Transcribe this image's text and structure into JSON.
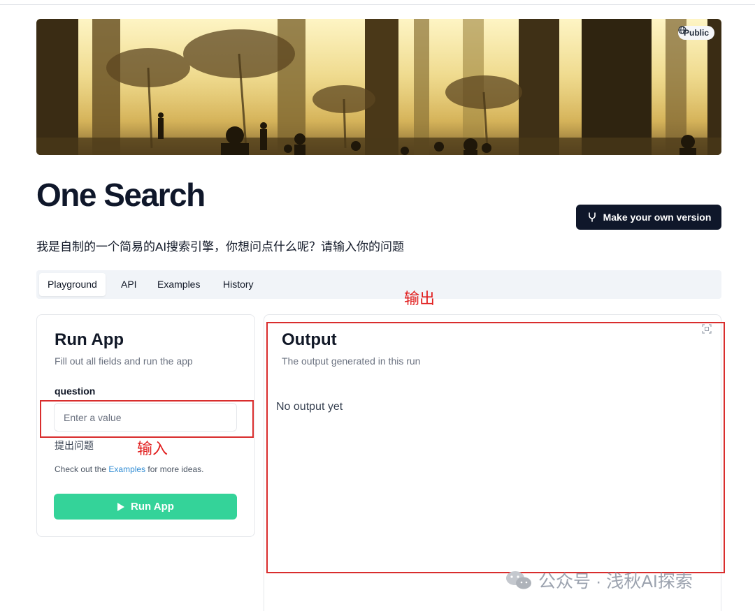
{
  "banner": {
    "visibility_label": "Public",
    "visibility_icon": "globe-icon"
  },
  "app": {
    "title": "One Search",
    "description": "我是自制的一个简易的AI搜索引擎，你想问点什么呢？请输入你的问题",
    "make_own_label": "Make your own version",
    "make_own_icon": "fork-icon"
  },
  "tabs": [
    {
      "label": "Playground",
      "active": true
    },
    {
      "label": "API",
      "active": false
    },
    {
      "label": "Examples",
      "active": false
    },
    {
      "label": "History",
      "active": false
    }
  ],
  "annotations": {
    "output": "输出",
    "input": "输入",
    "color": "#d92d2d"
  },
  "run_card": {
    "title": "Run App",
    "subtitle": "Fill out all fields and run the app",
    "field_label": "question",
    "field_placeholder": "Enter a value",
    "field_value": "",
    "field_hint": "提出问题",
    "examples_prefix": "Check out the ",
    "examples_link": "Examples",
    "examples_suffix": " for more ideas.",
    "run_label": "Run App",
    "run_icon": "play-icon"
  },
  "output_card": {
    "title": "Output",
    "subtitle": "The output generated in this run",
    "empty_text": "No output yet",
    "expand_icon": "expand-icon"
  },
  "watermark": {
    "text": "公众号 · 浅秋AI探索",
    "icon": "wechat-icon"
  },
  "colors": {
    "primary_dark": "#0f172a",
    "run_green": "#34d399",
    "link_blue": "#2e8bd3",
    "annotation_red": "#d92d2d"
  }
}
